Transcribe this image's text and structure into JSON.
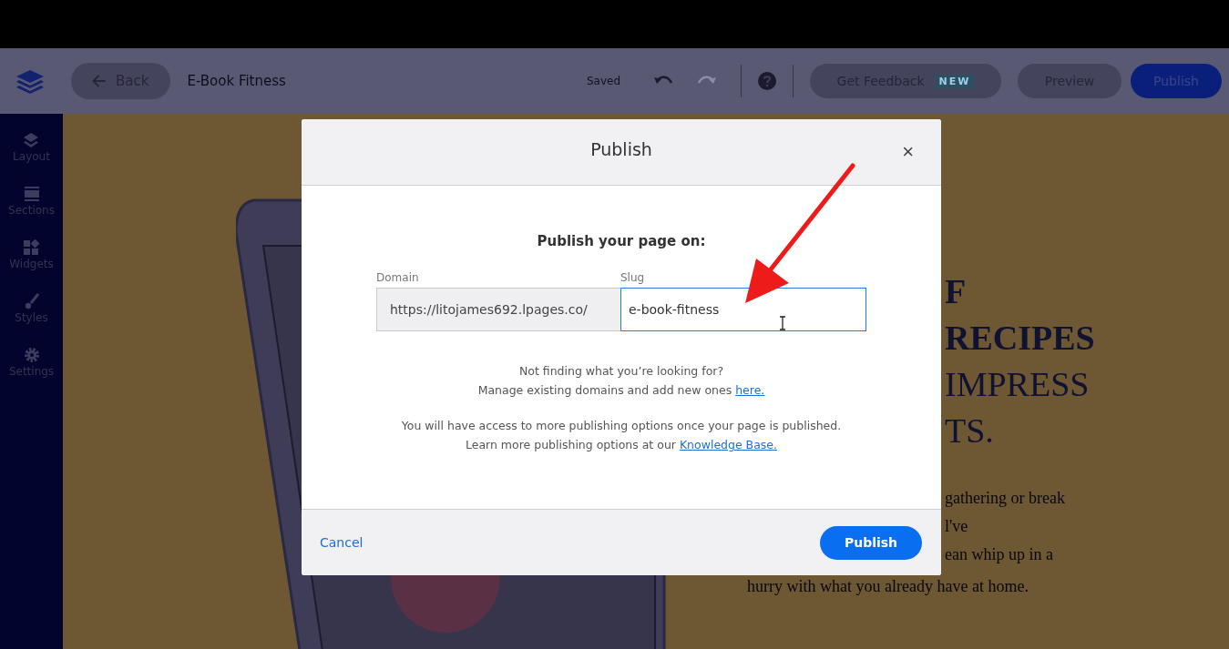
{
  "header": {
    "back": "Back",
    "title": "E-Book Fitness",
    "status": "Saved",
    "history": [
      {
        "kind": "undo",
        "disabled": false
      },
      {
        "kind": "redo",
        "disabled": true
      }
    ],
    "feedback": {
      "label": "Get Feedback",
      "badge": "NEW"
    },
    "preview": "Preview",
    "publish": "Publish"
  },
  "sidebar": {
    "items": [
      {
        "kind": "layout",
        "label": "Layout"
      },
      {
        "kind": "sections",
        "label": "Sections"
      },
      {
        "kind": "widgets",
        "label": "Widgets"
      },
      {
        "kind": "styles",
        "label": "Styles"
      },
      {
        "kind": "settings",
        "label": "Settings"
      }
    ]
  },
  "canvas": {
    "heading_lines": [
      {
        "text": "F",
        "bold": true
      },
      {
        "text": "RECIPES",
        "bold": true
      },
      {
        "text": "IMPRESS",
        "bold": false
      },
      {
        "text": "TS.",
        "bold": false
      }
    ],
    "body_lines": [
      "gathering or break",
      "l've",
      "ean whip up in a"
    ],
    "last_line": "hurry with what you already have at home."
  },
  "modal": {
    "title": "Publish",
    "close": "×",
    "heading": "Publish your page on:",
    "domain": {
      "label": "Domain",
      "value": "https://litojames692.lpages.co/",
      "disabled": true
    },
    "slug": {
      "label": "Slug",
      "value": "e-book-fitness",
      "focused": true
    },
    "info": [
      [
        {
          "text": "Not finding what you’re looking for?"
        },
        {
          "text": "Manage existing domains and add new ones ",
          "link": "here."
        }
      ],
      [
        {
          "text": "You will have access to more publishing options once your page is published."
        },
        {
          "text": "Learn more publishing options at our ",
          "link": "Knowledge Base."
        }
      ]
    ],
    "cancel": "Cancel",
    "publish": "Publish"
  }
}
